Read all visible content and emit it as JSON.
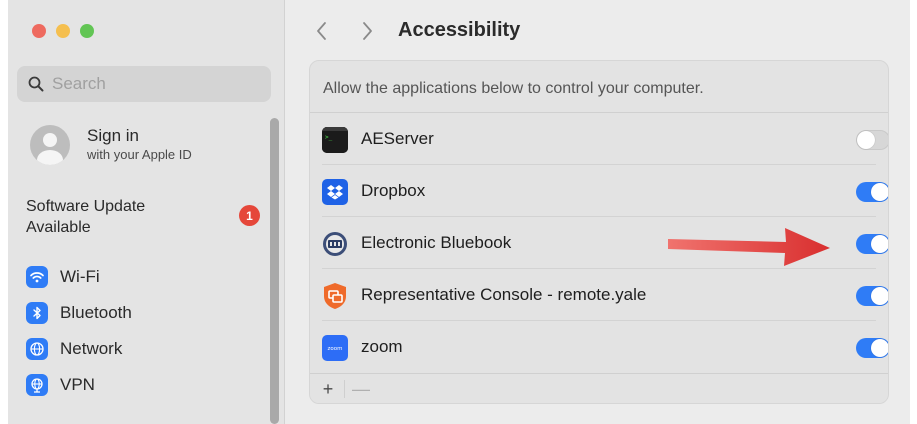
{
  "window": {
    "title": "Accessibility"
  },
  "sidebar": {
    "search": {
      "placeholder": "Search"
    },
    "account": {
      "title": "Sign in",
      "subtitle": "with your Apple ID"
    },
    "update": {
      "label": "Software Update Available",
      "badge": "1"
    },
    "items": [
      {
        "label": "Wi-Fi",
        "icon": "wifi-icon"
      },
      {
        "label": "Bluetooth",
        "icon": "bluetooth-icon"
      },
      {
        "label": "Network",
        "icon": "globe-icon"
      },
      {
        "label": "VPN",
        "icon": "vpn-globe-icon"
      }
    ]
  },
  "main": {
    "title": "Accessibility",
    "description": "Allow the applications below to control your computer.",
    "apps": [
      {
        "name": "AEServer",
        "enabled": false,
        "icon": "terminal-icon"
      },
      {
        "name": "Dropbox",
        "enabled": true,
        "icon": "dropbox-icon"
      },
      {
        "name": "Electronic Bluebook",
        "enabled": true,
        "icon": "bluebook-icon"
      },
      {
        "name": "Representative Console - remote.yale",
        "enabled": true,
        "icon": "representative-console-icon"
      },
      {
        "name": "zoom",
        "enabled": true,
        "icon": "zoom-icon"
      }
    ],
    "footer": {
      "add": "+",
      "remove": "—"
    }
  },
  "colors": {
    "accent": "#2f7cf6",
    "badge": "#e5473a",
    "arrow": "#e03a3a",
    "sidebar_bg": "#e4e4e4",
    "panel_bg": "#e3e3e3"
  }
}
